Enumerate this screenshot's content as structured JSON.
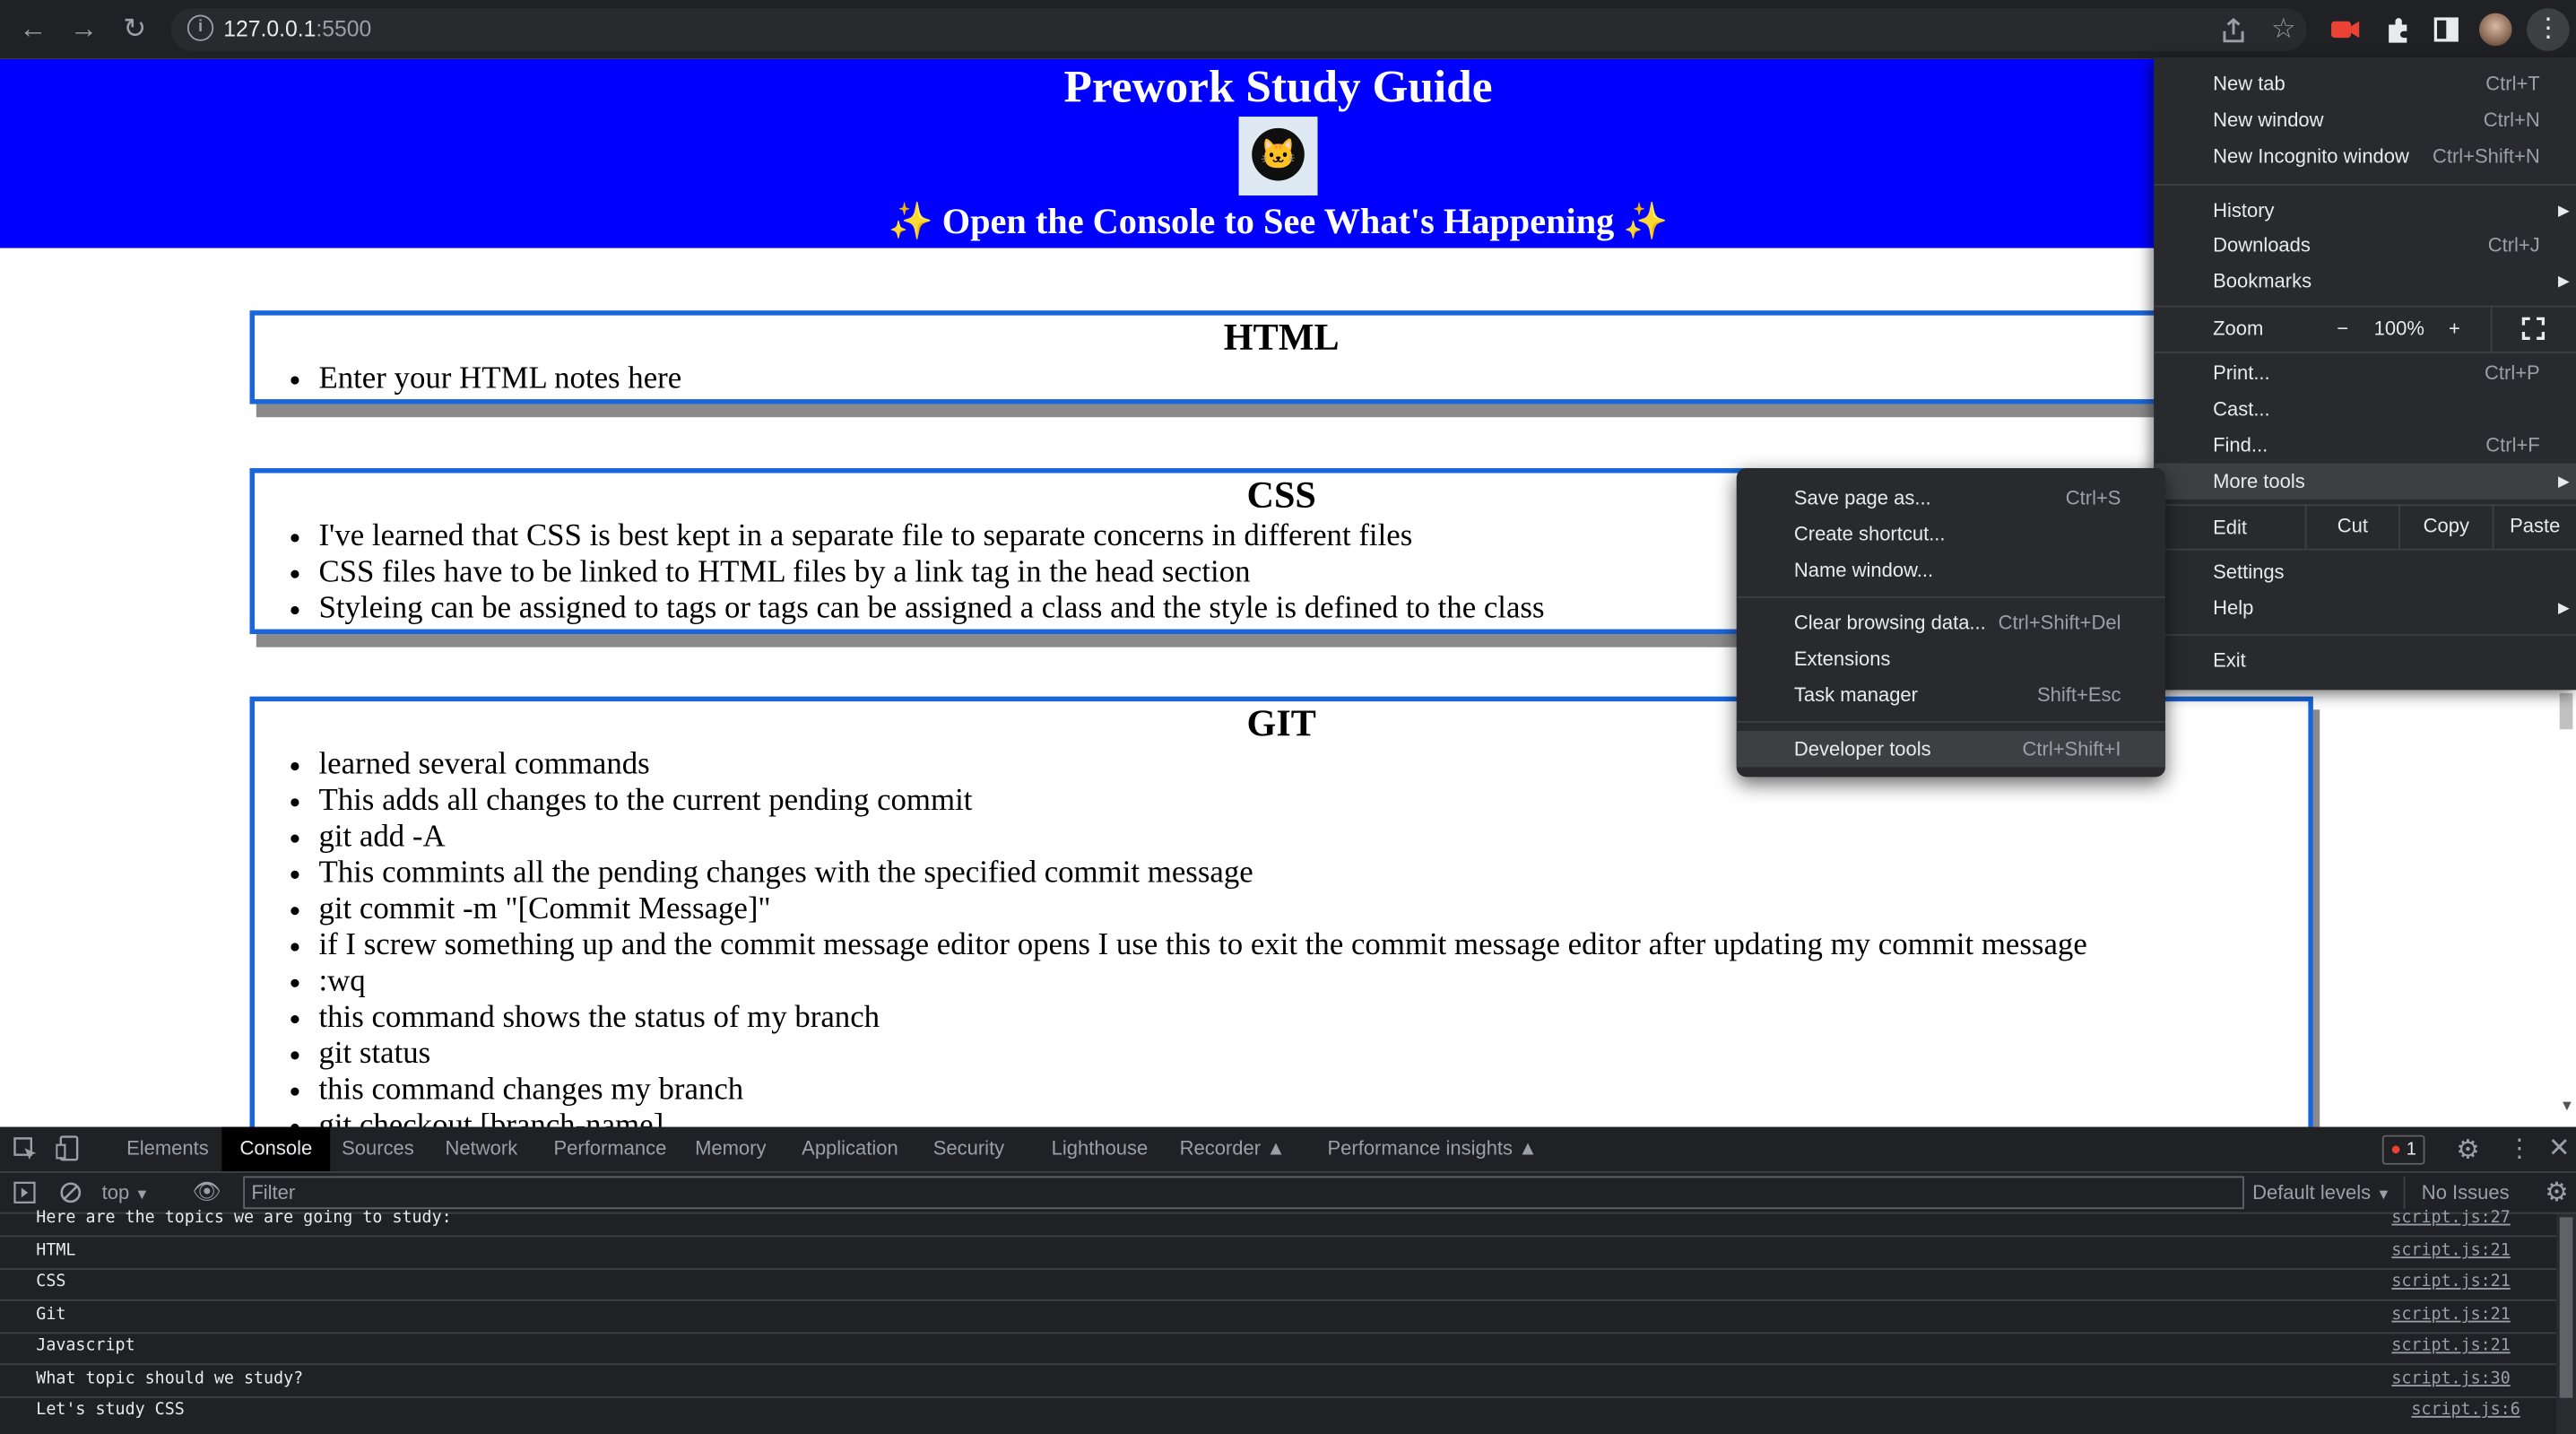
{
  "browser": {
    "url_host": "127.0.0.1",
    "url_port": ":5500"
  },
  "page": {
    "title": "Prework Study Guide",
    "subtitle": "✨ Open the Console to See What's Happening ✨",
    "sections": [
      {
        "heading": "HTML",
        "notes": [
          "Enter your HTML notes here"
        ]
      },
      {
        "heading": "CSS",
        "notes": [
          "I've learned that CSS is best kept in a separate file to separate concerns in different files",
          "CSS files have to be linked to HTML files by a link tag in the head section",
          "Styleing can be assigned to tags or tags can be assigned a class and the style is defined to the class"
        ]
      },
      {
        "heading": "GIT",
        "notes": [
          "learned several commands",
          "This adds all changes to the current pending commit",
          "git add -A",
          "This commints all the pending changes with the specified commit message",
          "git commit -m \"[Commit Message]\"",
          "if I screw something up and the commit message editor opens I use this to exit the commit message editor after updating my commit message",
          ":wq",
          "this command shows the status of my branch",
          "git status",
          "this command changes my branch",
          "git checkout [branch-name]"
        ]
      }
    ]
  },
  "devtools": {
    "tabs": [
      "Elements",
      "Console",
      "Sources",
      "Network",
      "Performance",
      "Memory",
      "Application",
      "Security",
      "Lighthouse",
      "Recorder",
      "Performance insights"
    ],
    "active_tab": "Console",
    "error_count": "1",
    "context": "top",
    "filter_placeholder": "Filter",
    "levels": "Default levels",
    "issues": "No Issues",
    "console": [
      {
        "msg": "Here are the topics we are going to study:",
        "src": "script.js:27"
      },
      {
        "msg": "HTML",
        "src": "script.js:21"
      },
      {
        "msg": "CSS",
        "src": "script.js:21"
      },
      {
        "msg": "Git",
        "src": "script.js:21"
      },
      {
        "msg": "Javascript",
        "src": "script.js:21"
      },
      {
        "msg": "What topic should we study?",
        "src": "script.js:30"
      },
      {
        "msg": "Let's study CSS",
        "src": "script.js:6"
      }
    ]
  },
  "menu": {
    "new_tab": "New tab",
    "new_tab_sc": "Ctrl+T",
    "new_window": "New window",
    "new_window_sc": "Ctrl+N",
    "incognito": "New Incognito window",
    "incognito_sc": "Ctrl+Shift+N",
    "history": "History",
    "downloads": "Downloads",
    "downloads_sc": "Ctrl+J",
    "bookmarks": "Bookmarks",
    "zoom": "Zoom",
    "zoom_minus": "−",
    "zoom_value": "100%",
    "zoom_plus": "+",
    "print": "Print...",
    "print_sc": "Ctrl+P",
    "cast": "Cast...",
    "find": "Find...",
    "find_sc": "Ctrl+F",
    "more_tools": "More tools",
    "edit": "Edit",
    "cut": "Cut",
    "copy": "Copy",
    "paste": "Paste",
    "settings": "Settings",
    "help": "Help",
    "exit": "Exit"
  },
  "submenu": {
    "save_page": "Save page as...",
    "save_page_sc": "Ctrl+S",
    "create_shortcut": "Create shortcut...",
    "name_window": "Name window...",
    "clear_data": "Clear browsing data...",
    "clear_data_sc": "Ctrl+Shift+Del",
    "extensions": "Extensions",
    "task_manager": "Task manager",
    "task_manager_sc": "Shift+Esc",
    "dev_tools": "Developer tools",
    "dev_tools_sc": "Ctrl+Shift+I"
  },
  "colors": {
    "hero_bg": "#0000ff",
    "card_border": "#1a66d9",
    "card_shadow": "#8a8a8a",
    "menu_bg": "#292a2d",
    "devtools_bg": "#202124"
  }
}
